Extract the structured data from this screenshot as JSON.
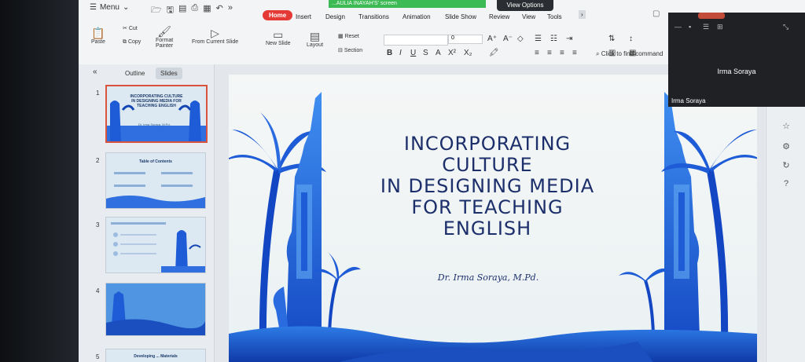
{
  "app": {
    "menu_label": "Menu",
    "share_banner": "...AULIA INAYAH'S' screen",
    "view_options": "View Options"
  },
  "tabs": [
    "Home",
    "Insert",
    "Design",
    "Transitions",
    "Animation",
    "Slide Show",
    "Review",
    "View",
    "Tools"
  ],
  "ribbon": {
    "paste": "Paste",
    "cut": "Cut",
    "copy": "Copy",
    "format_painter_1": "Format",
    "format_painter_2": "Painter",
    "from_current": "From Current Slide",
    "new_slide": "New Slide",
    "layout": "Layout",
    "reset": "Reset",
    "section": "Section",
    "font_size": "0",
    "find_placeholder": "Click to find command"
  },
  "left_panel": {
    "tab_outline": "Outline",
    "tab_slides": "Slides",
    "slides": [
      {
        "num": "1",
        "title": "INCORPORATING CULTURE IN DESIGNING MEDIA FOR TEACHING ENGLISH",
        "sub": "Dr. Irma Soraya, M.Pd."
      },
      {
        "num": "2",
        "title": "Table of Contents",
        "sub": ""
      },
      {
        "num": "3",
        "title": "",
        "sub": ""
      },
      {
        "num": "4",
        "title": "",
        "sub": ""
      },
      {
        "num": "5",
        "title": "Developing ... Materials",
        "sub": ""
      }
    ]
  },
  "slide": {
    "title_lines": [
      "INCORPORATING",
      "CULTURE",
      "IN DESIGNING MEDIA",
      "FOR TEACHING",
      "ENGLISH"
    ],
    "author": "Dr. Irma Soraya, M.Pd."
  },
  "video": {
    "participant": "Irma Soraya",
    "label": "Irma Soraya"
  },
  "colors": {
    "home_tab": "#e53935",
    "slide_blue": "#1e5bd6",
    "title_navy": "#1c2f6b"
  }
}
